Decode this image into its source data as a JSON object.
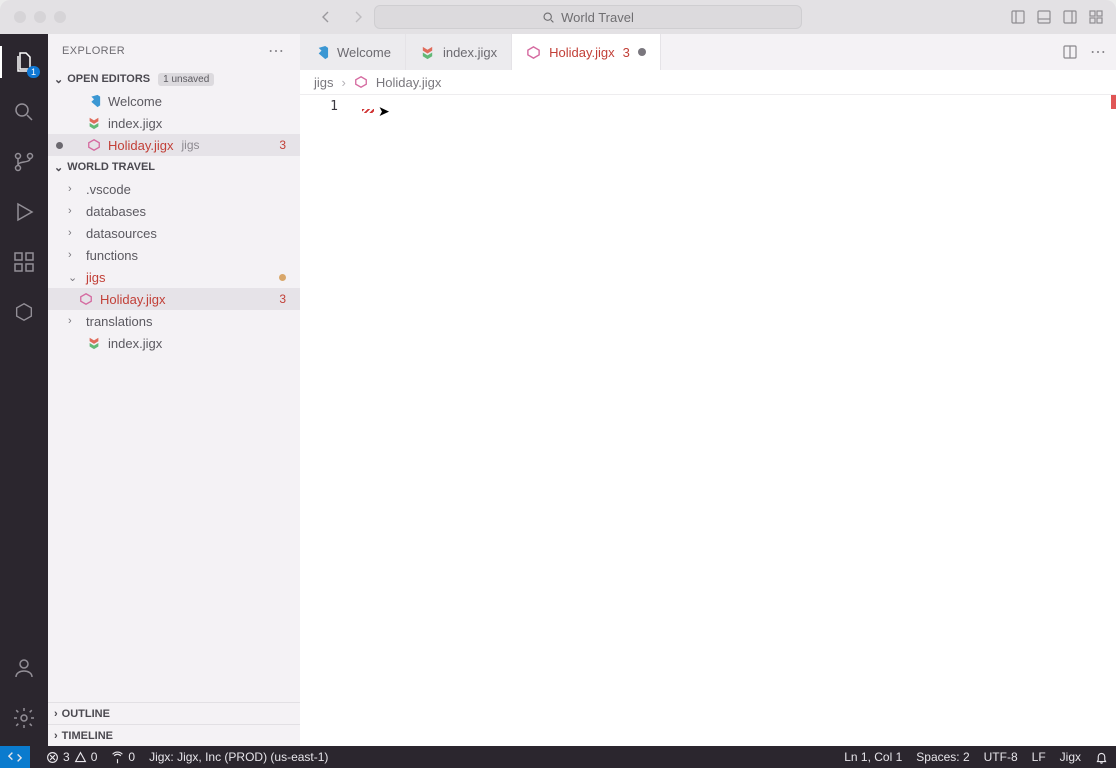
{
  "titlebar": {
    "search_text": "World Travel"
  },
  "sidebar": {
    "title": "EXPLORER",
    "open_editors": {
      "label": "OPEN EDITORS",
      "unsaved_pill": "1 unsaved",
      "items": [
        {
          "name": "Welcome"
        },
        {
          "name": "index.jigx"
        },
        {
          "name": "Holiday.jigx",
          "dir": "jigs",
          "error": true,
          "modified": true,
          "count": "3"
        }
      ]
    },
    "workspace": {
      "label": "WORLD TRAVEL",
      "items": [
        {
          "name": ".vscode",
          "type": "folder"
        },
        {
          "name": "databases",
          "type": "folder"
        },
        {
          "name": "datasources",
          "type": "folder"
        },
        {
          "name": "functions",
          "type": "folder"
        },
        {
          "name": "jigs",
          "type": "folder",
          "expanded": true,
          "error": true,
          "mdot": true
        },
        {
          "name": "Holiday.jigx",
          "type": "file",
          "indent": 2,
          "error": true,
          "count": "3",
          "selected": true
        },
        {
          "name": "translations",
          "type": "folder"
        },
        {
          "name": "index.jigx",
          "type": "file"
        }
      ]
    },
    "outline_label": "OUTLINE",
    "timeline_label": "TIMELINE"
  },
  "tabs": [
    {
      "label": "Welcome",
      "icon": "vscode"
    },
    {
      "label": "index.jigx",
      "icon": "jigx"
    },
    {
      "label": "Holiday.jigx",
      "icon": "jigx-err",
      "active": true,
      "count": "3",
      "modified": true
    }
  ],
  "breadcrumbs": {
    "seg1": "jigs",
    "seg2": "Holiday.jigx"
  },
  "editor": {
    "line_no": "1"
  },
  "status": {
    "errors": "3",
    "warnings": "0",
    "ports": "0",
    "profile": "Jigx: Jigx, Inc (PROD) (us-east-1)",
    "cursor": "Ln 1, Col 1",
    "spaces": "Spaces: 2",
    "encoding": "UTF-8",
    "eol": "LF",
    "lang": "Jigx"
  }
}
